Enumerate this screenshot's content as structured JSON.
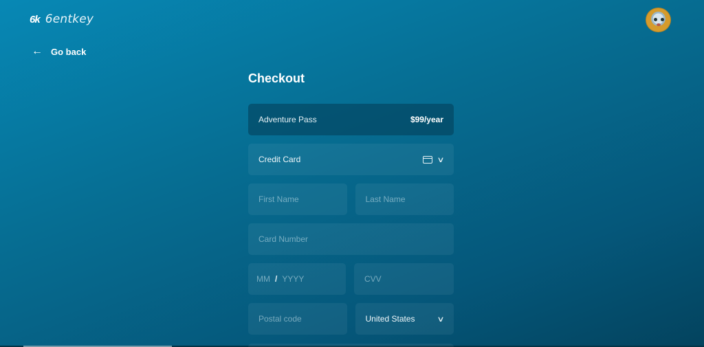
{
  "header": {
    "logo_mark": "6k",
    "logo_text": "6entkey",
    "avatar_alt": "user avatar"
  },
  "nav": {
    "go_back_icon": "arrow-left-icon",
    "go_back_label": "Go back"
  },
  "checkout": {
    "title": "Checkout",
    "summary": {
      "product": "Adventure Pass",
      "price": "$99/year"
    },
    "payment_method": {
      "selected": "Credit Card",
      "icons": [
        "credit-card-icon",
        "chevron-down-icon"
      ]
    },
    "fields": {
      "first_name_placeholder": "First Name",
      "last_name_placeholder": "Last Name",
      "card_number_placeholder": "Card Number",
      "exp_month_placeholder": "MM",
      "exp_separator": "/",
      "exp_year_placeholder": "YYYY",
      "cvv_placeholder": "CVV",
      "postal_code_placeholder": "Postal code",
      "country_selected": "United States"
    }
  }
}
